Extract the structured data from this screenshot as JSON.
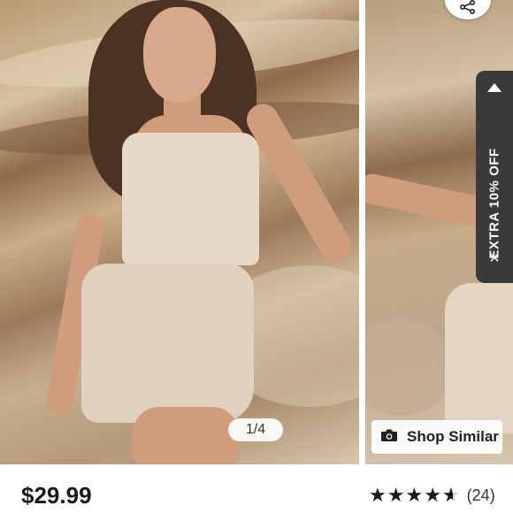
{
  "gallery": {
    "page_indicator": "1/4",
    "shop_similar_label": "Shop Similar"
  },
  "promo": {
    "text": "EXTRA 10% OFF",
    "close_symbol": "×"
  },
  "product": {
    "price": "$29.99",
    "rating_value": 4.5,
    "review_count": "(24)"
  },
  "icons": {
    "share": "share-icon",
    "camera": "camera-icon",
    "close": "close-icon"
  },
  "colors": {
    "promo_bg": "#3a3a3a",
    "text_dark": "#1a1a1a"
  }
}
